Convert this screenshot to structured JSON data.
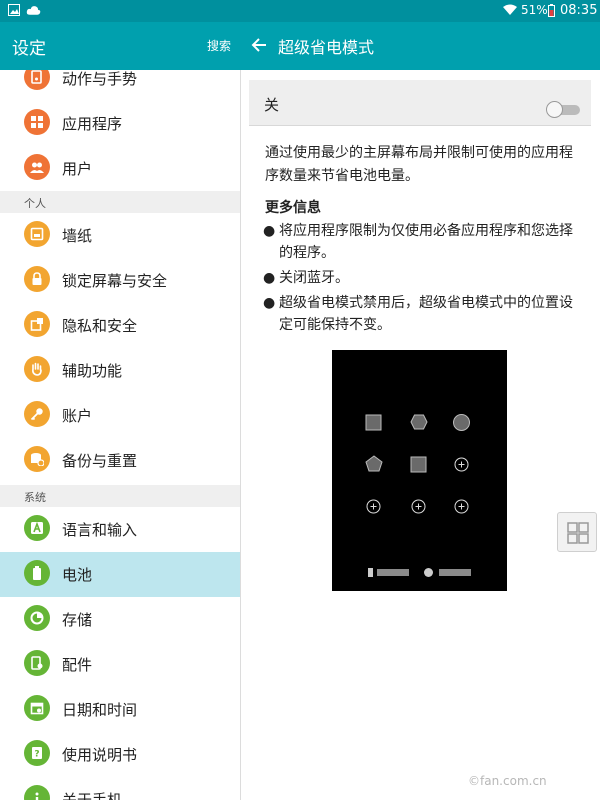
{
  "status_bar": {
    "battery": "51%",
    "time": "08:35"
  },
  "left_header": {
    "title": "设定",
    "search_label": "搜索"
  },
  "right_header": {
    "title": "超级省电模式"
  },
  "left_list": {
    "items_top": [
      {
        "label": "动作与手势",
        "icon": "gesture-icon",
        "color": "#ef7336"
      },
      {
        "label": "应用程序",
        "icon": "apps-icon",
        "color": "#ef7336"
      },
      {
        "label": "用户",
        "icon": "users-icon",
        "color": "#ef7336"
      }
    ],
    "section_personal": "个人",
    "items_personal": [
      {
        "label": "墙纸",
        "icon": "wallpaper-icon",
        "color": "#f2a530"
      },
      {
        "label": "锁定屏幕与安全",
        "icon": "lock-icon",
        "color": "#f2a530"
      },
      {
        "label": "隐私和安全",
        "icon": "privacy-icon",
        "color": "#f2a530"
      },
      {
        "label": "辅助功能",
        "icon": "hand-icon",
        "color": "#f2a530"
      },
      {
        "label": "账户",
        "icon": "key-icon",
        "color": "#f2a530"
      },
      {
        "label": "备份与重置",
        "icon": "backup-icon",
        "color": "#f2a530"
      }
    ],
    "section_system": "系统",
    "items_system": [
      {
        "label": "语言和输入",
        "icon": "language-icon",
        "color": "#65b536"
      },
      {
        "label": "电池",
        "icon": "battery-icon",
        "color": "#65b536",
        "selected": true
      },
      {
        "label": "存储",
        "icon": "storage-icon",
        "color": "#65b536"
      },
      {
        "label": "配件",
        "icon": "accessory-icon",
        "color": "#65b536"
      },
      {
        "label": "日期和时间",
        "icon": "calendar-icon",
        "color": "#65b536"
      },
      {
        "label": "使用说明书",
        "icon": "manual-icon",
        "color": "#65b536"
      },
      {
        "label": "关于手机",
        "icon": "info-icon",
        "color": "#65b536"
      }
    ]
  },
  "right_panel": {
    "toggle_label": "关",
    "toggle_on": false,
    "description": "通过使用最少的主屏幕布局并限制可使用的应用程序数量来节省电池电量。",
    "more_info_title": "更多信息",
    "bullets": [
      "将应用程序限制为仅使用必备应用程序和您选择的程序。",
      "关闭蓝牙。",
      "超级省电模式禁用后，超级省电模式中的位置设定可能保持不变。"
    ]
  },
  "watermark": "©fan.com.cn",
  "colors": {
    "status_bar": "#00909e",
    "app_bar": "#00a0ae",
    "selected_row": "#bde6ee"
  }
}
